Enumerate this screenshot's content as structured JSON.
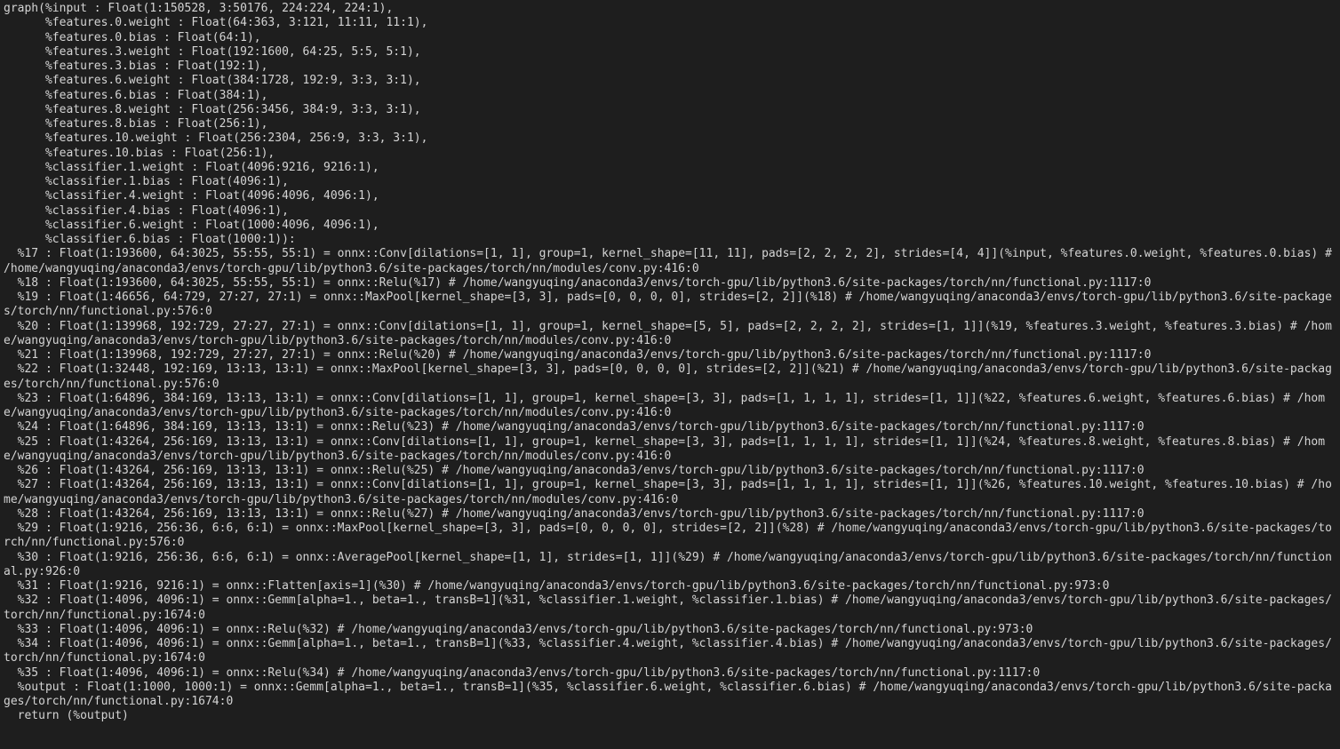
{
  "console": {
    "lines": [
      "graph(%input : Float(1:150528, 3:50176, 224:224, 224:1),",
      "      %features.0.weight : Float(64:363, 3:121, 11:11, 11:1),",
      "      %features.0.bias : Float(64:1),",
      "      %features.3.weight : Float(192:1600, 64:25, 5:5, 5:1),",
      "      %features.3.bias : Float(192:1),",
      "      %features.6.weight : Float(384:1728, 192:9, 3:3, 3:1),",
      "      %features.6.bias : Float(384:1),",
      "      %features.8.weight : Float(256:3456, 384:9, 3:3, 3:1),",
      "      %features.8.bias : Float(256:1),",
      "      %features.10.weight : Float(256:2304, 256:9, 3:3, 3:1),",
      "      %features.10.bias : Float(256:1),",
      "      %classifier.1.weight : Float(4096:9216, 9216:1),",
      "      %classifier.1.bias : Float(4096:1),",
      "      %classifier.4.weight : Float(4096:4096, 4096:1),",
      "      %classifier.4.bias : Float(4096:1),",
      "      %classifier.6.weight : Float(1000:4096, 4096:1),",
      "      %classifier.6.bias : Float(1000:1)):",
      "  %17 : Float(1:193600, 64:3025, 55:55, 55:1) = onnx::Conv[dilations=[1, 1], group=1, kernel_shape=[11, 11], pads=[2, 2, 2, 2], strides=[4, 4]](%input, %features.0.weight, %features.0.bias) # /home/wangyuqing/anaconda3/envs/torch-gpu/lib/python3.6/site-packages/torch/nn/modules/conv.py:416:0",
      "  %18 : Float(1:193600, 64:3025, 55:55, 55:1) = onnx::Relu(%17) # /home/wangyuqing/anaconda3/envs/torch-gpu/lib/python3.6/site-packages/torch/nn/functional.py:1117:0",
      "  %19 : Float(1:46656, 64:729, 27:27, 27:1) = onnx::MaxPool[kernel_shape=[3, 3], pads=[0, 0, 0, 0], strides=[2, 2]](%18) # /home/wangyuqing/anaconda3/envs/torch-gpu/lib/python3.6/site-packages/torch/nn/functional.py:576:0",
      "  %20 : Float(1:139968, 192:729, 27:27, 27:1) = onnx::Conv[dilations=[1, 1], group=1, kernel_shape=[5, 5], pads=[2, 2, 2, 2], strides=[1, 1]](%19, %features.3.weight, %features.3.bias) # /home/wangyuqing/anaconda3/envs/torch-gpu/lib/python3.6/site-packages/torch/nn/modules/conv.py:416:0",
      "  %21 : Float(1:139968, 192:729, 27:27, 27:1) = onnx::Relu(%20) # /home/wangyuqing/anaconda3/envs/torch-gpu/lib/python3.6/site-packages/torch/nn/functional.py:1117:0",
      "  %22 : Float(1:32448, 192:169, 13:13, 13:1) = onnx::MaxPool[kernel_shape=[3, 3], pads=[0, 0, 0, 0], strides=[2, 2]](%21) # /home/wangyuqing/anaconda3/envs/torch-gpu/lib/python3.6/site-packages/torch/nn/functional.py:576:0",
      "  %23 : Float(1:64896, 384:169, 13:13, 13:1) = onnx::Conv[dilations=[1, 1], group=1, kernel_shape=[3, 3], pads=[1, 1, 1, 1], strides=[1, 1]](%22, %features.6.weight, %features.6.bias) # /home/wangyuqing/anaconda3/envs/torch-gpu/lib/python3.6/site-packages/torch/nn/modules/conv.py:416:0",
      "  %24 : Float(1:64896, 384:169, 13:13, 13:1) = onnx::Relu(%23) # /home/wangyuqing/anaconda3/envs/torch-gpu/lib/python3.6/site-packages/torch/nn/functional.py:1117:0",
      "  %25 : Float(1:43264, 256:169, 13:13, 13:1) = onnx::Conv[dilations=[1, 1], group=1, kernel_shape=[3, 3], pads=[1, 1, 1, 1], strides=[1, 1]](%24, %features.8.weight, %features.8.bias) # /home/wangyuqing/anaconda3/envs/torch-gpu/lib/python3.6/site-packages/torch/nn/modules/conv.py:416:0",
      "  %26 : Float(1:43264, 256:169, 13:13, 13:1) = onnx::Relu(%25) # /home/wangyuqing/anaconda3/envs/torch-gpu/lib/python3.6/site-packages/torch/nn/functional.py:1117:0",
      "  %27 : Float(1:43264, 256:169, 13:13, 13:1) = onnx::Conv[dilations=[1, 1], group=1, kernel_shape=[3, 3], pads=[1, 1, 1, 1], strides=[1, 1]](%26, %features.10.weight, %features.10.bias) # /home/wangyuqing/anaconda3/envs/torch-gpu/lib/python3.6/site-packages/torch/nn/modules/conv.py:416:0",
      "  %28 : Float(1:43264, 256:169, 13:13, 13:1) = onnx::Relu(%27) # /home/wangyuqing/anaconda3/envs/torch-gpu/lib/python3.6/site-packages/torch/nn/functional.py:1117:0",
      "  %29 : Float(1:9216, 256:36, 6:6, 6:1) = onnx::MaxPool[kernel_shape=[3, 3], pads=[0, 0, 0, 0], strides=[2, 2]](%28) # /home/wangyuqing/anaconda3/envs/torch-gpu/lib/python3.6/site-packages/torch/nn/functional.py:576:0",
      "  %30 : Float(1:9216, 256:36, 6:6, 6:1) = onnx::AveragePool[kernel_shape=[1, 1], strides=[1, 1]](%29) # /home/wangyuqing/anaconda3/envs/torch-gpu/lib/python3.6/site-packages/torch/nn/functional.py:926:0",
      "  %31 : Float(1:9216, 9216:1) = onnx::Flatten[axis=1](%30) # /home/wangyuqing/anaconda3/envs/torch-gpu/lib/python3.6/site-packages/torch/nn/functional.py:973:0",
      "  %32 : Float(1:4096, 4096:1) = onnx::Gemm[alpha=1., beta=1., transB=1](%31, %classifier.1.weight, %classifier.1.bias) # /home/wangyuqing/anaconda3/envs/torch-gpu/lib/python3.6/site-packages/torch/nn/functional.py:1674:0",
      "  %33 : Float(1:4096, 4096:1) = onnx::Relu(%32) # /home/wangyuqing/anaconda3/envs/torch-gpu/lib/python3.6/site-packages/torch/nn/functional.py:973:0",
      "  %34 : Float(1:4096, 4096:1) = onnx::Gemm[alpha=1., beta=1., transB=1](%33, %classifier.4.weight, %classifier.4.bias) # /home/wangyuqing/anaconda3/envs/torch-gpu/lib/python3.6/site-packages/torch/nn/functional.py:1674:0",
      "  %35 : Float(1:4096, 4096:1) = onnx::Relu(%34) # /home/wangyuqing/anaconda3/envs/torch-gpu/lib/python3.6/site-packages/torch/nn/functional.py:1117:0",
      "  %output : Float(1:1000, 1000:1) = onnx::Gemm[alpha=1., beta=1., transB=1](%35, %classifier.6.weight, %classifier.6.bias) # /home/wangyuqing/anaconda3/envs/torch-gpu/lib/python3.6/site-packages/torch/nn/functional.py:1674:0",
      "  return (%output)"
    ]
  }
}
